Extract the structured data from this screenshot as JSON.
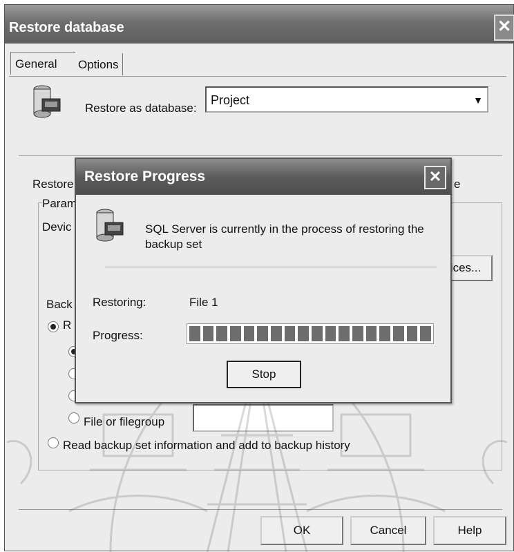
{
  "window": {
    "title": "Restore database",
    "close_glyph": "✕",
    "tabs": [
      {
        "label": "General",
        "selected": true
      },
      {
        "label": "Options",
        "selected": false
      }
    ],
    "restore_as_label": "Restore as database:",
    "restore_as_value": "Project",
    "restore_label": "Restore:",
    "restore_label_right_fragment": "e",
    "parameters_label": "Parame",
    "device_label": "Devic",
    "devices_button_fragment": "ices...",
    "backup_label": "Back",
    "radio_r_fragment": "R",
    "file_or_filegroup_label": "File or filegroup",
    "read_backup_label": "Read backup set information and add to backup history",
    "buttons": {
      "ok": "OK",
      "cancel": "Cancel",
      "help": "Help"
    }
  },
  "progress_dialog": {
    "title": "Restore Progress",
    "close_glyph": "✕",
    "message_line1": "SQL Server is currently in the process of restoring the",
    "message_line2": "backup set",
    "restoring_label": "Restoring:",
    "restoring_value": "File 1",
    "progress_label": "Progress:",
    "progress_fraction": 1.0,
    "stop_button": "Stop"
  },
  "icons": {
    "database": "database-icon",
    "window_close": "close-icon",
    "dialog_close": "close-icon"
  }
}
